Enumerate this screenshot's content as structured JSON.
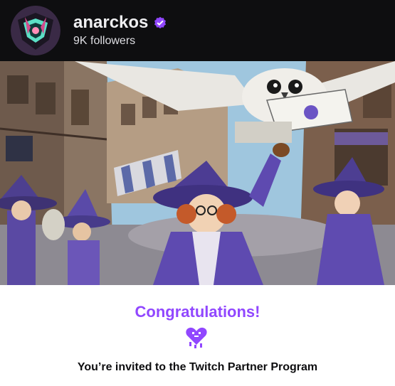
{
  "channel": {
    "name": "anarckos",
    "followers": "9K followers",
    "verified_icon": "verified-badge-icon"
  },
  "colors": {
    "header_bg": "#0e0e10",
    "accent": "#9147ff",
    "text_dark": "#0e0e10"
  },
  "banner": {
    "illustration": "witches-owl-letter-artwork"
  },
  "message": {
    "heading": "Congratulations!",
    "icon": "heart-icon",
    "body": "You’re invited to the Twitch Partner Program"
  }
}
